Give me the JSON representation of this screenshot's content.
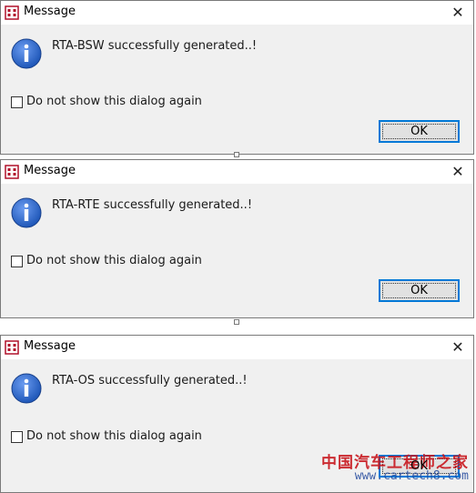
{
  "dialogs": [
    {
      "title": "Message",
      "close_glyph": "✕",
      "icon": "info-icon",
      "message": "RTA-BSW successfully generated..!",
      "checkbox_label": "Do not show this dialog again",
      "checkbox_checked": false,
      "ok_label": "OK"
    },
    {
      "title": "Message",
      "close_glyph": "✕",
      "icon": "info-icon",
      "message": "RTA-RTE successfully generated..!",
      "checkbox_label": "Do not show this dialog again",
      "checkbox_checked": false,
      "ok_label": "OK"
    },
    {
      "title": "Message",
      "close_glyph": "✕",
      "icon": "info-icon",
      "message": "RTA-OS successfully generated..!",
      "checkbox_label": "Do not show this dialog again",
      "checkbox_checked": false,
      "ok_label": "OK"
    }
  ],
  "watermark": {
    "line1": "中国汽车工程师之家",
    "line2": "www.cartech8.com"
  },
  "colors": {
    "dialog_bg": "#f0f0f0",
    "titlebar_bg": "#ffffff",
    "ok_border": "#0078d7",
    "info_blue": "#1f57b8",
    "watermark_red": "#c8161d"
  }
}
